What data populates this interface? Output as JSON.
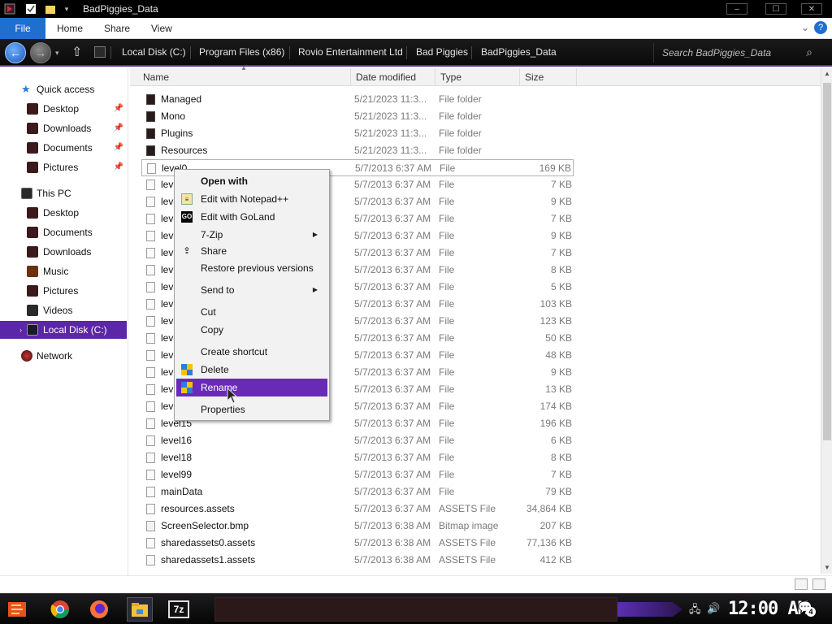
{
  "window": {
    "title": "BadPiggies_Data",
    "minimize": "–",
    "maximize": "☐",
    "close": "✕"
  },
  "ribbon": {
    "tabs": [
      "File",
      "Home",
      "Share",
      "View"
    ]
  },
  "navbar": {
    "breadcrumb": [
      "Local Disk (C:)",
      "Program Files (x86)",
      "Rovio Entertainment Ltd",
      "Bad Piggies",
      "BadPiggies_Data"
    ],
    "search_placeholder": "Search BadPiggies_Data"
  },
  "sidebar": {
    "quick_access": {
      "label": "Quick access",
      "items": [
        "Desktop",
        "Downloads",
        "Documents",
        "Pictures"
      ]
    },
    "this_pc": {
      "label": "This PC",
      "items": [
        "Desktop",
        "Documents",
        "Downloads",
        "Music",
        "Pictures",
        "Videos",
        "Local Disk (C:)"
      ]
    },
    "network": "Network",
    "selected": "Local Disk (C:)"
  },
  "columns": [
    "Name",
    "Date modified",
    "Type",
    "Size"
  ],
  "files": [
    {
      "name": "Managed",
      "date": "5/21/2023 11:3...",
      "type": "File folder",
      "size": "",
      "kind": "folder"
    },
    {
      "name": "Mono",
      "date": "5/21/2023 11:3...",
      "type": "File folder",
      "size": "",
      "kind": "folder"
    },
    {
      "name": "Plugins",
      "date": "5/21/2023 11:3...",
      "type": "File folder",
      "size": "",
      "kind": "folder"
    },
    {
      "name": "Resources",
      "date": "5/21/2023 11:3...",
      "type": "File folder",
      "size": "",
      "kind": "folder"
    },
    {
      "name": "level0",
      "date": "5/7/2013 6:37 AM",
      "type": "File",
      "size": "169 KB",
      "kind": "file"
    },
    {
      "name": "lev",
      "date": "5/7/2013 6:37 AM",
      "type": "File",
      "size": "7 KB",
      "kind": "file"
    },
    {
      "name": "lev",
      "date": "5/7/2013 6:37 AM",
      "type": "File",
      "size": "9 KB",
      "kind": "file"
    },
    {
      "name": "lev",
      "date": "5/7/2013 6:37 AM",
      "type": "File",
      "size": "7 KB",
      "kind": "file"
    },
    {
      "name": "lev",
      "date": "5/7/2013 6:37 AM",
      "type": "File",
      "size": "9 KB",
      "kind": "file"
    },
    {
      "name": "lev",
      "date": "5/7/2013 6:37 AM",
      "type": "File",
      "size": "7 KB",
      "kind": "file"
    },
    {
      "name": "lev",
      "date": "5/7/2013 6:37 AM",
      "type": "File",
      "size": "8 KB",
      "kind": "file"
    },
    {
      "name": "lev",
      "date": "5/7/2013 6:37 AM",
      "type": "File",
      "size": "5 KB",
      "kind": "file"
    },
    {
      "name": "lev",
      "date": "5/7/2013 6:37 AM",
      "type": "File",
      "size": "103 KB",
      "kind": "file"
    },
    {
      "name": "lev",
      "date": "5/7/2013 6:37 AM",
      "type": "File",
      "size": "123 KB",
      "kind": "file"
    },
    {
      "name": "lev",
      "date": "5/7/2013 6:37 AM",
      "type": "File",
      "size": "50 KB",
      "kind": "file"
    },
    {
      "name": "lev",
      "date": "5/7/2013 6:37 AM",
      "type": "File",
      "size": "48 KB",
      "kind": "file"
    },
    {
      "name": "lev",
      "date": "5/7/2013 6:37 AM",
      "type": "File",
      "size": "9 KB",
      "kind": "file"
    },
    {
      "name": "lev",
      "date": "5/7/2013 6:37 AM",
      "type": "File",
      "size": "13 KB",
      "kind": "file"
    },
    {
      "name": "lev",
      "date": "5/7/2013 6:37 AM",
      "type": "File",
      "size": "174 KB",
      "kind": "file"
    },
    {
      "name": "level15",
      "date": "5/7/2013 6:37 AM",
      "type": "File",
      "size": "196 KB",
      "kind": "file"
    },
    {
      "name": "level16",
      "date": "5/7/2013 6:37 AM",
      "type": "File",
      "size": "6 KB",
      "kind": "file"
    },
    {
      "name": "level18",
      "date": "5/7/2013 6:37 AM",
      "type": "File",
      "size": "8 KB",
      "kind": "file"
    },
    {
      "name": "level99",
      "date": "5/7/2013 6:37 AM",
      "type": "File",
      "size": "7 KB",
      "kind": "file"
    },
    {
      "name": "mainData",
      "date": "5/7/2013 6:37 AM",
      "type": "File",
      "size": "79 KB",
      "kind": "file"
    },
    {
      "name": "resources.assets",
      "date": "5/7/2013 6:37 AM",
      "type": "ASSETS File",
      "size": "34,864 KB",
      "kind": "file"
    },
    {
      "name": "ScreenSelector.bmp",
      "date": "5/7/2013 6:38 AM",
      "type": "Bitmap image",
      "size": "207 KB",
      "kind": "bmp"
    },
    {
      "name": "sharedassets0.assets",
      "date": "5/7/2013 6:38 AM",
      "type": "ASSETS File",
      "size": "77,136 KB",
      "kind": "file"
    },
    {
      "name": "sharedassets1.assets",
      "date": "5/7/2013 6:38 AM",
      "type": "ASSETS File",
      "size": "412 KB",
      "kind": "file"
    }
  ],
  "context_menu": {
    "items": [
      {
        "label": "Open with",
        "icon": "",
        "submenu": false,
        "bold": true
      },
      {
        "label": "Edit with Notepad++",
        "icon": "notepad-icon",
        "submenu": false
      },
      {
        "label": "Edit with GoLand",
        "icon": "goland-icon",
        "submenu": false
      },
      {
        "label": "7-Zip",
        "icon": "",
        "submenu": true
      },
      {
        "label": "Share",
        "icon": "share-icon",
        "submenu": false
      },
      {
        "label": "Restore previous versions",
        "icon": "",
        "submenu": false
      },
      {
        "label": "Send to",
        "icon": "",
        "submenu": true
      },
      {
        "label": "Cut",
        "icon": "",
        "submenu": false
      },
      {
        "label": "Copy",
        "icon": "",
        "submenu": false
      },
      {
        "label": "Create shortcut",
        "icon": "",
        "submenu": false
      },
      {
        "label": "Delete",
        "icon": "shield-icon",
        "submenu": false
      },
      {
        "label": "Rename",
        "icon": "shield-icon",
        "submenu": false,
        "highlighted": true
      },
      {
        "label": "Properties",
        "icon": "",
        "submenu": false
      }
    ],
    "goland_icon_text": "GO"
  },
  "taskbar": {
    "apps": [
      "start-icon",
      "chrome-icon",
      "firefox-icon",
      "file-explorer-icon",
      "7zip-icon"
    ],
    "sevenzip_label": "7z",
    "clock": "12:00 AM",
    "notification_count": "4"
  },
  "colors": {
    "accent_purple": "#5b27a6",
    "highlight_purple": "#6a2ab8",
    "file_tab_blue": "#1f6fcf"
  }
}
